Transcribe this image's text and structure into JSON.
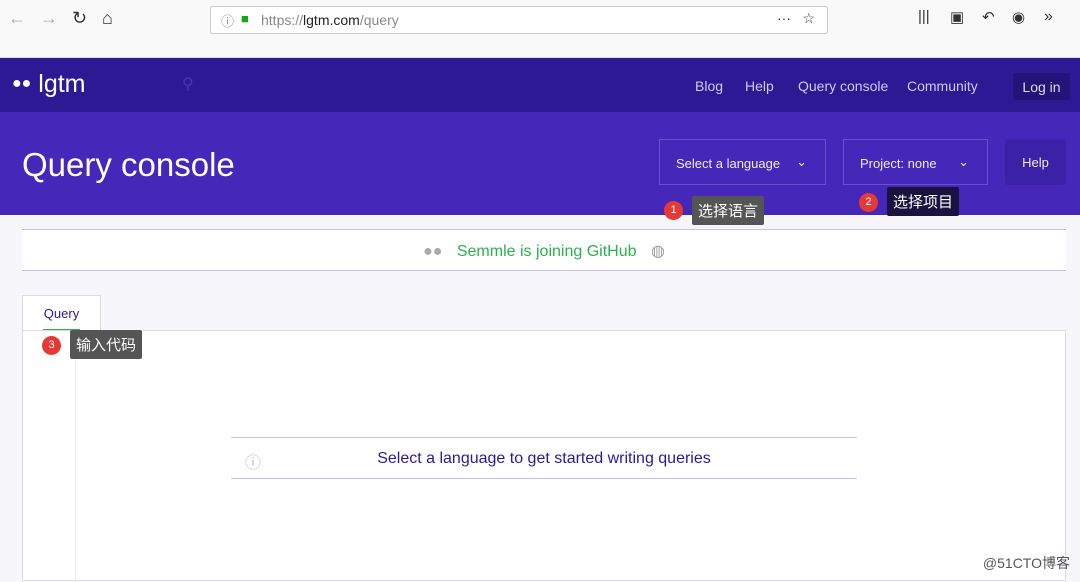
{
  "browser": {
    "url_scheme": "https://",
    "url_host": "lgtm.com",
    "url_path": "/query"
  },
  "nav": {
    "logo": "lgtm",
    "links": [
      "Blog",
      "Help",
      "Query console",
      "Community"
    ],
    "login": "Log in"
  },
  "hero": {
    "title": "Query console",
    "language_select": "Select a language",
    "project_select": "Project: none",
    "help": "Help"
  },
  "annotations": [
    {
      "num": "1",
      "text": "选择语言"
    },
    {
      "num": "2",
      "text": "选择项目"
    },
    {
      "num": "3",
      "text": "输入代码"
    }
  ],
  "banner": {
    "text": "Semmle is joining GitHub"
  },
  "tabs": {
    "query": "Query"
  },
  "editor": {
    "message": "Select a language to get started writing queries"
  },
  "watermark": "@51CTO博客"
}
